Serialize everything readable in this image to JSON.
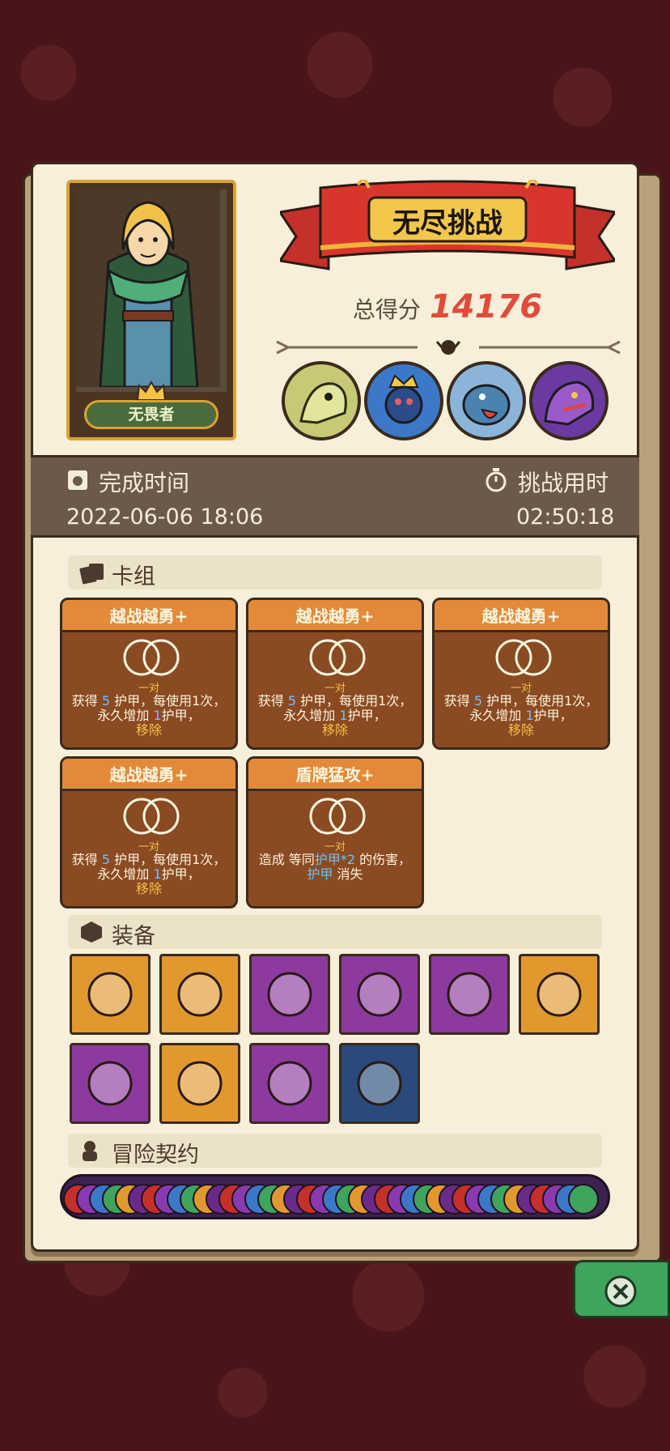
{
  "mode_title": "无尽挑战",
  "hero": {
    "name": "无畏者"
  },
  "score": {
    "label": "总得分",
    "value": "14176"
  },
  "time": {
    "finish_label": "完成时间",
    "finish_value": "2022-06-06 18:06",
    "duration_label": "挑战用时",
    "duration_value": "02:50:18"
  },
  "sections": {
    "deck": "卡组",
    "equipment": "装备",
    "contract": "冒险契约"
  },
  "cards": [
    {
      "name": "越战越勇+",
      "sub": "一对",
      "desc_parts": [
        "获得 ",
        "5",
        " 护甲，每使用1次，永久增加 ",
        "1",
        "护甲，",
        "移除"
      ]
    },
    {
      "name": "越战越勇+",
      "sub": "一对",
      "desc_parts": [
        "获得 ",
        "5",
        " 护甲，每使用1次，永久增加 ",
        "1",
        "护甲，",
        "移除"
      ]
    },
    {
      "name": "越战越勇+",
      "sub": "一对",
      "desc_parts": [
        "获得 ",
        "5",
        " 护甲，每使用1次，永久增加 ",
        "1",
        "护甲，",
        "移除"
      ]
    },
    {
      "name": "越战越勇+",
      "sub": "一对",
      "desc_parts": [
        "获得 ",
        "5",
        " 护甲，每使用1次，永久增加 ",
        "1",
        "护甲，",
        "移除"
      ]
    },
    {
      "name": "盾牌猛攻+",
      "sub": "一对",
      "desc_parts": [
        "造成 等同",
        "护甲*2",
        " 的伤害，",
        "护甲",
        " 消失",
        ""
      ]
    }
  ],
  "equipment": [
    {
      "icon": "ice-shield-icon",
      "color": "orange"
    },
    {
      "icon": "spiked-armor-icon",
      "color": "orange"
    },
    {
      "icon": "gold-mirror-icon",
      "color": "purple"
    },
    {
      "icon": "demon-mask-icon",
      "color": "purple"
    },
    {
      "icon": "bat-wings-icon",
      "color": "purple"
    },
    {
      "icon": "round-shield-icon",
      "color": "orange"
    },
    {
      "icon": "moon-star-icon",
      "color": "purple"
    },
    {
      "icon": "mushroom-icon",
      "color": "orange"
    },
    {
      "icon": "rune-shield-icon",
      "color": "purple"
    },
    {
      "icon": "chest-armor-icon",
      "color": "navy"
    }
  ],
  "bosses": [
    "bone-dragon-icon",
    "crowned-spider-icon",
    "rhino-beast-icon",
    "purple-dragon-icon"
  ],
  "colors": {
    "accent_red": "#e24a3a",
    "panel": "#f7efd9",
    "band": "#6b5a4a"
  }
}
